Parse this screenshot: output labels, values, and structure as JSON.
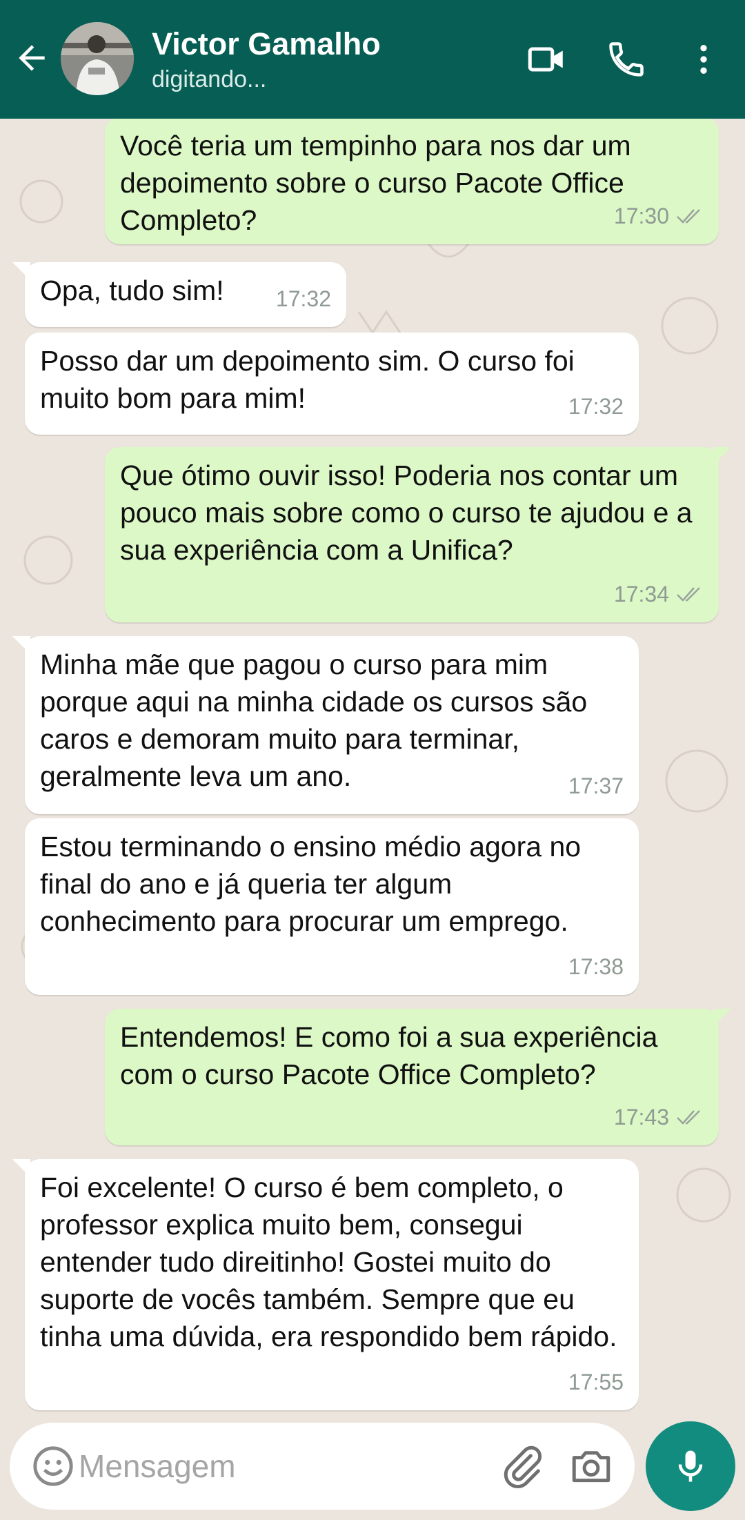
{
  "header": {
    "contact_name": "Victor Gamalho",
    "status": "digitando...",
    "icons": [
      "back-arrow-icon",
      "video-call-icon",
      "phone-icon",
      "more-vert-icon"
    ],
    "color": "#075e54"
  },
  "messages": [
    {
      "dir": "out",
      "text": "Você teria um tempinho para nos dar um depoimento sobre o curso Pacote Office Completo?",
      "time": "17:30",
      "read": true
    },
    {
      "dir": "in",
      "text": "Opa, tudo sim!",
      "time": "17:32"
    },
    {
      "dir": "in",
      "text": "Posso dar um depoimento sim. O curso foi muito bom para mim!",
      "time": "17:32"
    },
    {
      "dir": "out",
      "text": "Que ótimo ouvir isso! Poderia nos contar um pouco mais sobre como o curso te ajudou e a sua experiência com a Unifica?",
      "time": "17:34",
      "read": true
    },
    {
      "dir": "in",
      "text": "Minha mãe que pagou o curso para mim porque aqui na minha cidade os cursos são caros e demoram muito para terminar, geralmente leva um ano.",
      "time": "17:37"
    },
    {
      "dir": "in",
      "text": "Estou terminando o ensino médio agora no final do ano e já queria ter algum conhecimento para procurar um emprego.",
      "time": "17:38"
    },
    {
      "dir": "out",
      "text": "Entendemos! E como foi a sua experiência com o curso Pacote Office Completo?",
      "time": "17:43",
      "read": true
    },
    {
      "dir": "in",
      "text": "Foi excelente! O curso é bem completo, o professor explica muito bem, consegui entender tudo direitinho! Gostei muito do suporte de vocês também. Sempre que eu tinha uma dúvida, era respondido bem rápido.",
      "time": "17:55"
    }
  ],
  "input": {
    "placeholder": "Mensagem",
    "value": "",
    "icons": [
      "emoji-icon",
      "attach-icon",
      "camera-icon",
      "mic-icon"
    ]
  },
  "colors": {
    "incoming": "#ffffff",
    "outgoing": "#dcf8c6",
    "background": "#ece5dd",
    "accent": "#128c7e"
  }
}
